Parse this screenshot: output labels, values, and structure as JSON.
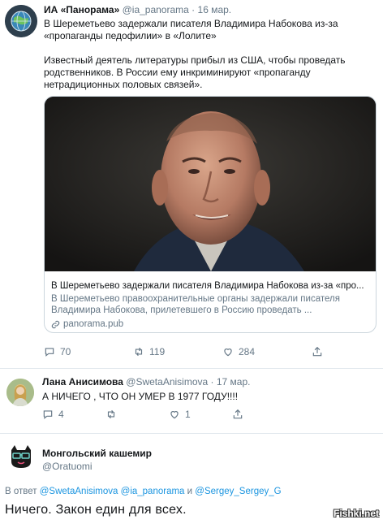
{
  "tweet1": {
    "name": "ИА «Панорама»",
    "handle": "@ia_panorama",
    "separator": "·",
    "date": "16 мар.",
    "text_lines": [
      "В Шереметьево задержали писателя Владимира Набокова из-за",
      "«пропаганды педофилии» в «Лолите»",
      "",
      "Известный деятель литературы прибыл из США, чтобы проведать",
      "родственников. В России ему инкриминируют «пропаганду",
      "нетрадиционных половых связей»."
    ],
    "card": {
      "title": "В Шереметьево задержали писателя Владимира Набокова из-за «про...",
      "desc_lines": [
        "В Шереметьево правоохранительные органы задержали писателя",
        "Владимира Набокова, прилетевшего в Россию проведать ..."
      ],
      "link": "panorama.pub"
    },
    "actions": {
      "replies": "70",
      "retweets": "119",
      "likes": "284"
    }
  },
  "tweet2": {
    "name": "Лана Анисимова",
    "handle": "@SwetaAnisimova",
    "separator": "·",
    "date": "17 мар.",
    "text": "А НИЧЕГО , ЧТО ОН УМЕР В 1977 ГОДУ!!!!",
    "actions": {
      "replies": "4",
      "retweets": "",
      "likes": "1"
    }
  },
  "tweet3": {
    "name": "Монгольский кашемир",
    "handle": "@Oratuomi",
    "reply_prefix": "В ответ",
    "mentions": [
      "@SwetaAnisimova",
      "@ia_panorama",
      "@Sergey_Sergey_G"
    ],
    "mention_joiner": "и",
    "text": "Ничего. Закон един для всех."
  },
  "watermark": "Fishki.net",
  "colors": {
    "text": "#14171a",
    "muted": "#657786",
    "link": "#1b95e0",
    "border": "#ccd6dd"
  }
}
